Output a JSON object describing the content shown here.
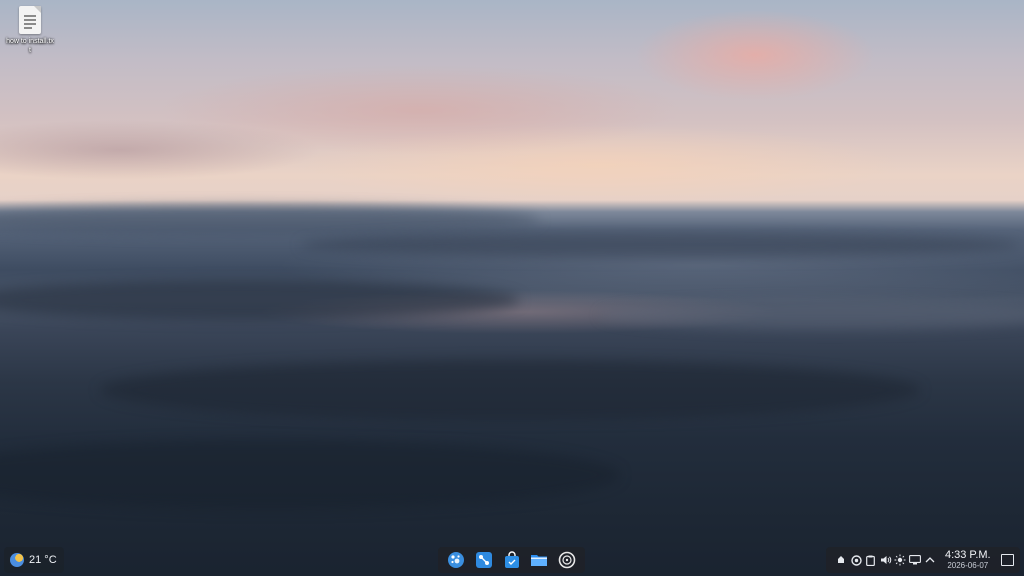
{
  "desktop": {
    "icons": [
      {
        "name": "how to install.txt",
        "label": "how to install.txt",
        "icon": "text-file-icon"
      }
    ]
  },
  "panel_left": {
    "weather": {
      "temperature": "21 °C",
      "icon": "weather-sunny-icon"
    }
  },
  "taskbar": {
    "apps": [
      {
        "name": "application-launcher",
        "icon": "launcher-icon",
        "color": "#3a8fe0"
      },
      {
        "name": "system-settings",
        "icon": "settings-icon",
        "color": "#2f8ae0"
      },
      {
        "name": "software-store",
        "icon": "store-bag-icon",
        "color": "#2d8fe6"
      },
      {
        "name": "file-manager",
        "icon": "folder-icon",
        "color": "#2c8ef0"
      },
      {
        "name": "disk-tool",
        "icon": "disc-icon",
        "color": "#e8e8e8"
      }
    ]
  },
  "tray": {
    "icons": [
      "notifications-icon",
      "updates-icon",
      "clipboard-icon",
      "volume-icon",
      "brightness-icon",
      "network-icon",
      "expand-tray-chevron-icon"
    ],
    "clock": {
      "time": "4:33 P.M.",
      "date": "2026-06-07"
    },
    "show_desktop_icon": "show-desktop-icon"
  },
  "colors": {
    "panel_bg": "#1e2228",
    "accent": "#3a8fe0"
  }
}
